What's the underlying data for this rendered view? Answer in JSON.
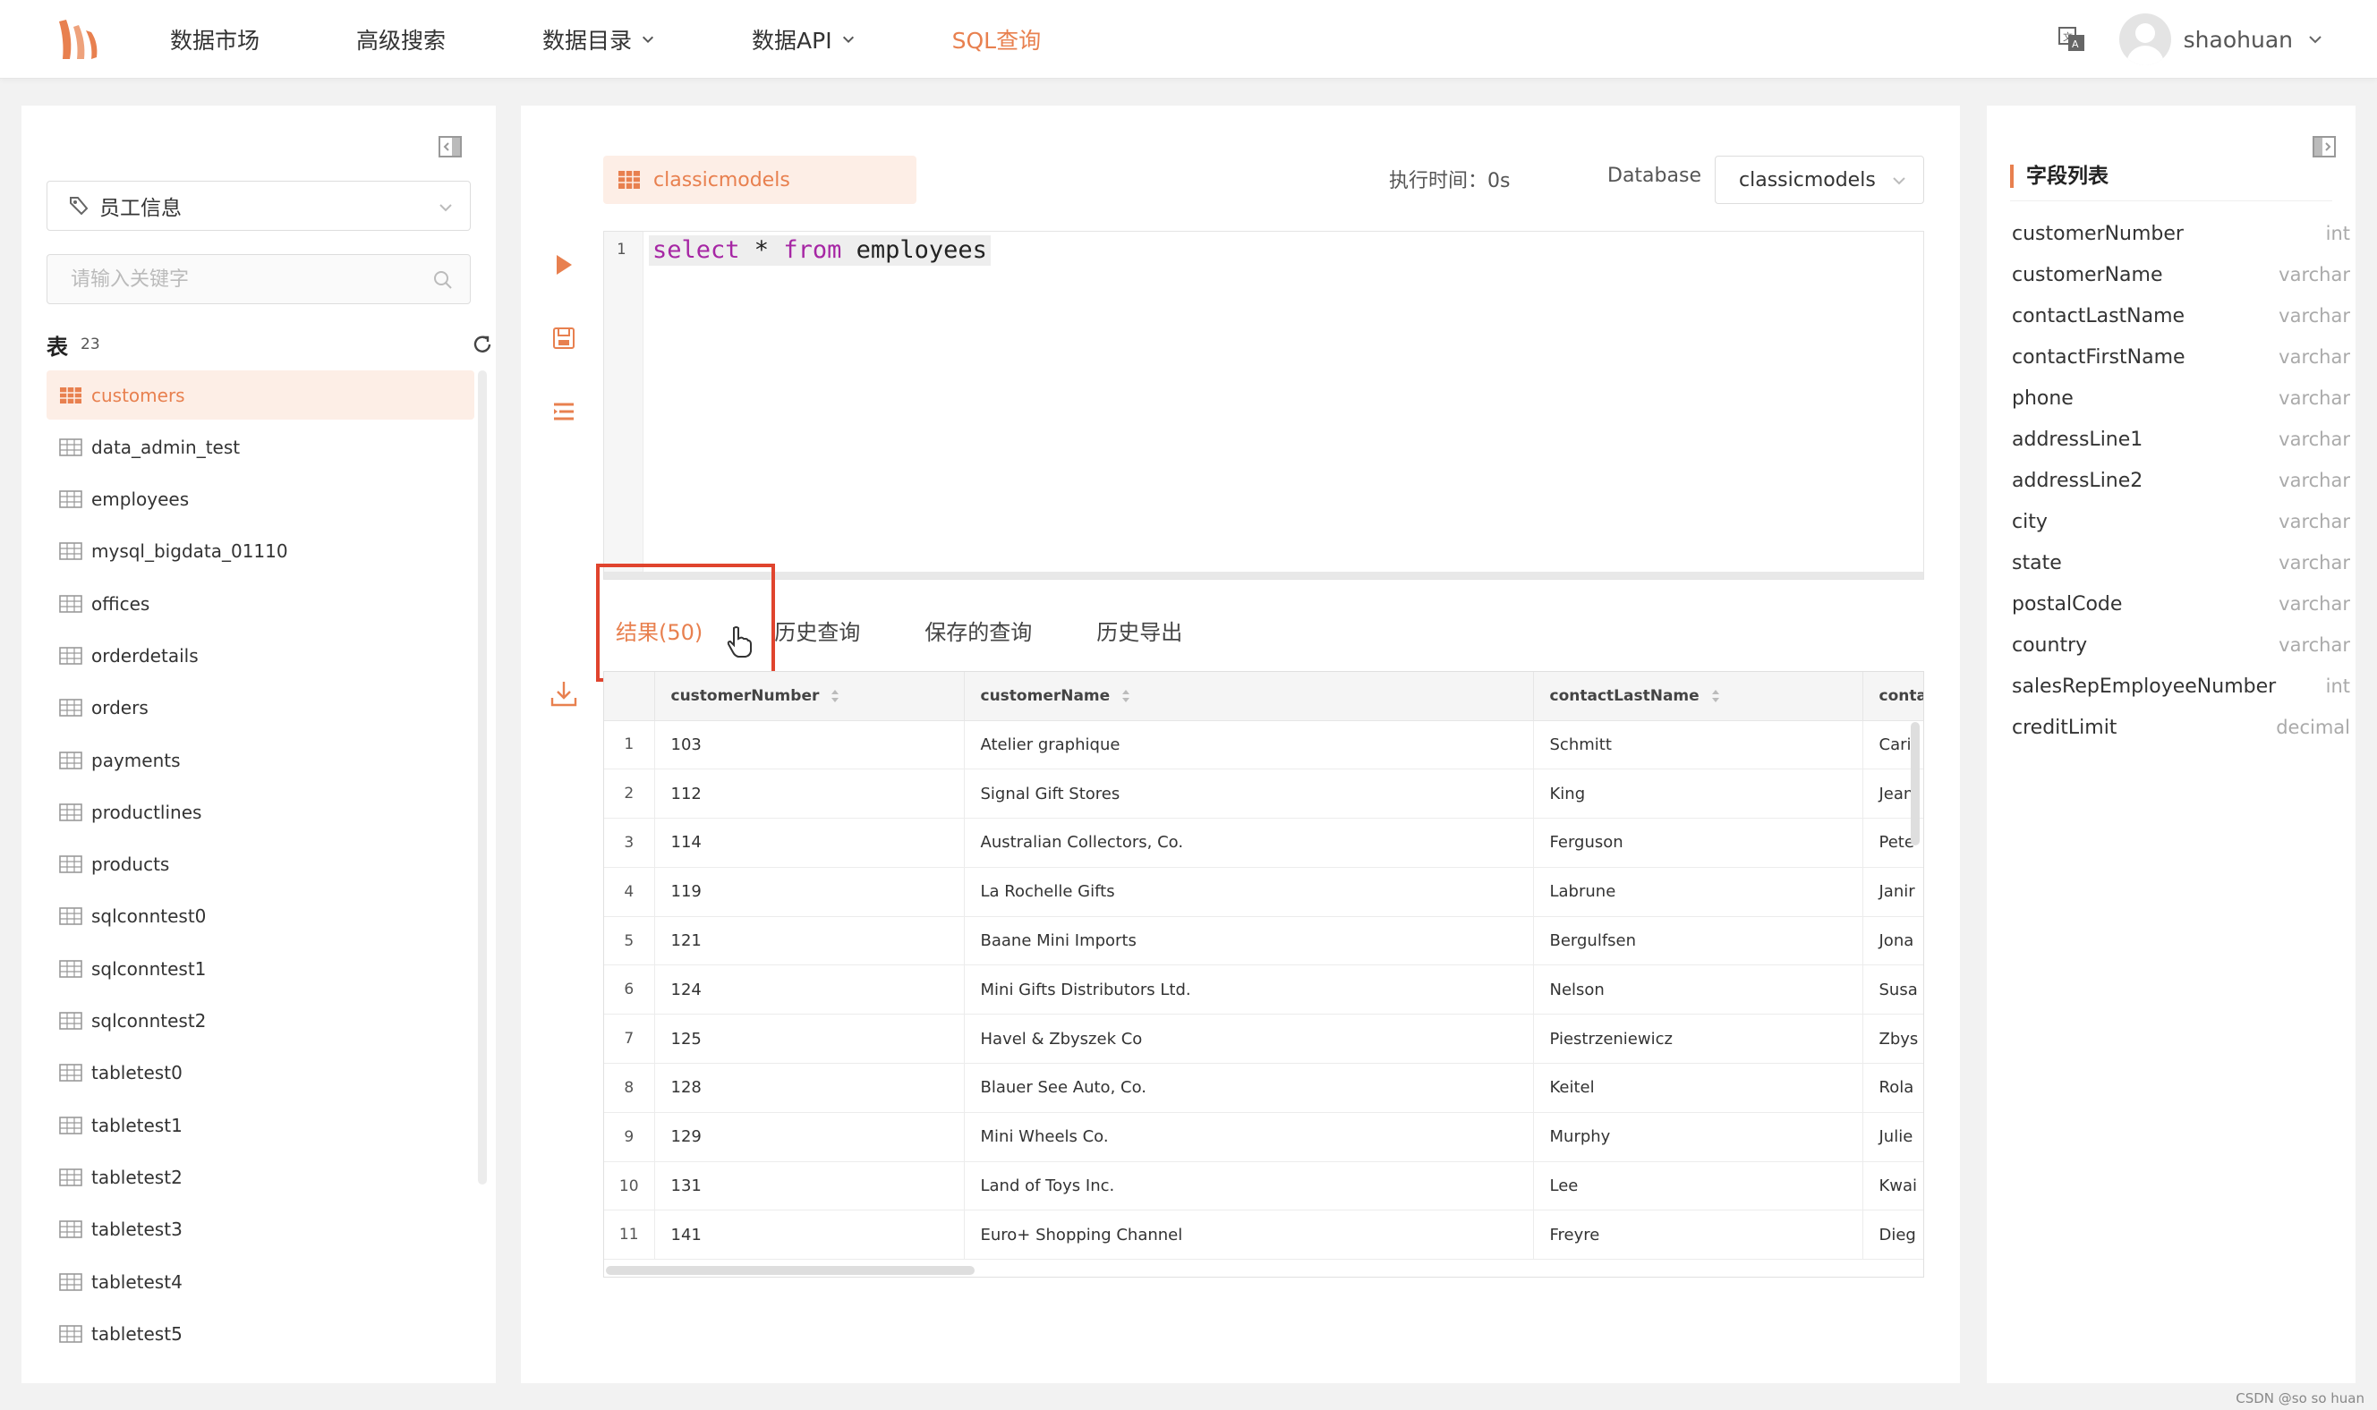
{
  "nav": {
    "items": [
      {
        "label": "数据市场",
        "dropdown": false,
        "active": false
      },
      {
        "label": "高级搜索",
        "dropdown": false,
        "active": false
      },
      {
        "label": "数据目录",
        "dropdown": true,
        "active": false
      },
      {
        "label": "数据API",
        "dropdown": true,
        "active": false
      },
      {
        "label": "SQL查询",
        "dropdown": false,
        "active": true
      }
    ],
    "username": "shaohuan"
  },
  "left": {
    "db_select": "员工信息",
    "search_placeholder": "请输入关键字",
    "tables_label": "表",
    "tables_count": "23",
    "tables": [
      "customers",
      "data_admin_test",
      "employees",
      "mysql_bigdata_01110",
      "offices",
      "orderdetails",
      "orders",
      "payments",
      "productlines",
      "products",
      "sqlconntest0",
      "sqlconntest1",
      "sqlconntest2",
      "tabletest0",
      "tabletest1",
      "tabletest2",
      "tabletest3",
      "tabletest4",
      "tabletest5"
    ],
    "selected_table": "customers"
  },
  "editor": {
    "tab_label": "classicmodels",
    "exec_time": "执行时间：0s",
    "database_label": "Database",
    "database_value": "classicmodels",
    "line_number": "1",
    "sql_tokens": [
      {
        "text": "select",
        "kw": true
      },
      {
        "text": " * ",
        "kw": false
      },
      {
        "text": "from",
        "kw": true
      },
      {
        "text": " employees",
        "kw": false
      }
    ]
  },
  "results": {
    "tabs": [
      "结果(50)",
      "历史查询",
      "保存的查询",
      "历史导出"
    ],
    "columns": [
      "customerNumber",
      "customerName",
      "contactLastName",
      "conta"
    ],
    "rows": [
      [
        "1",
        "103",
        "Atelier graphique",
        "Schmitt",
        "Carii"
      ],
      [
        "2",
        "112",
        "Signal Gift Stores",
        "King",
        "Jean"
      ],
      [
        "3",
        "114",
        "Australian Collectors, Co.",
        "Ferguson",
        "Pete"
      ],
      [
        "4",
        "119",
        "La Rochelle Gifts",
        "Labrune",
        "Janir"
      ],
      [
        "5",
        "121",
        "Baane Mini Imports",
        "Bergulfsen",
        "Jona"
      ],
      [
        "6",
        "124",
        "Mini Gifts Distributors Ltd.",
        "Nelson",
        "Susa"
      ],
      [
        "7",
        "125",
        "Havel & Zbyszek Co",
        "Piestrzeniewicz",
        "Zbys"
      ],
      [
        "8",
        "128",
        "Blauer See Auto, Co.",
        "Keitel",
        "Rola"
      ],
      [
        "9",
        "129",
        "Mini Wheels Co.",
        "Murphy",
        "Julie"
      ],
      [
        "10",
        "131",
        "Land of Toys Inc.",
        "Lee",
        "Kwai"
      ],
      [
        "11",
        "141",
        "Euro+ Shopping Channel",
        "Freyre",
        "Dieg"
      ]
    ]
  },
  "fields": {
    "title": "字段列表",
    "items": [
      {
        "name": "customerNumber",
        "type": "int"
      },
      {
        "name": "customerName",
        "type": "varchar"
      },
      {
        "name": "contactLastName",
        "type": "varchar"
      },
      {
        "name": "contactFirstName",
        "type": "varchar"
      },
      {
        "name": "phone",
        "type": "varchar"
      },
      {
        "name": "addressLine1",
        "type": "varchar"
      },
      {
        "name": "addressLine2",
        "type": "varchar"
      },
      {
        "name": "city",
        "type": "varchar"
      },
      {
        "name": "state",
        "type": "varchar"
      },
      {
        "name": "postalCode",
        "type": "varchar"
      },
      {
        "name": "country",
        "type": "varchar"
      },
      {
        "name": "salesRepEmployeeNumber",
        "type": "int"
      },
      {
        "name": "creditLimit",
        "type": "decimal"
      }
    ]
  },
  "watermark": "CSDN @so so huan",
  "colors": {
    "accent": "#e8804f",
    "highlight": "#e0442e",
    "keyword": "#a626a4"
  }
}
